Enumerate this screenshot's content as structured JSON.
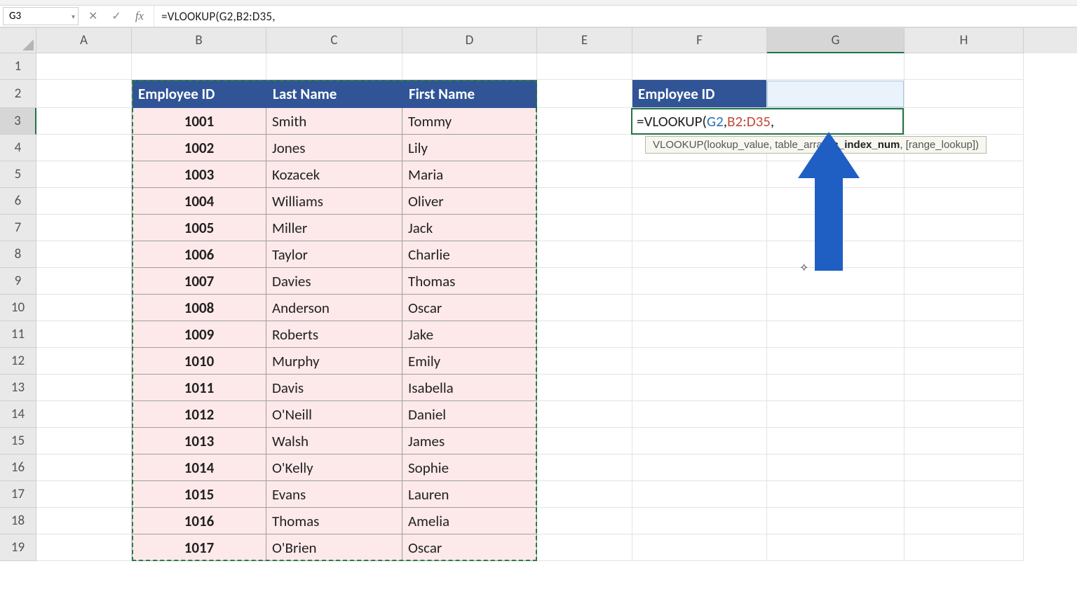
{
  "formula_bar": {
    "name_box": "G3",
    "cancel": "✕",
    "enter": "✓",
    "fx": "fx",
    "formula_text": "=VLOOKUP(G2,B2:D35,"
  },
  "columns": [
    "A",
    "B",
    "C",
    "D",
    "E",
    "F",
    "G",
    "H"
  ],
  "rows": [
    "1",
    "2",
    "3",
    "4",
    "5",
    "6",
    "7",
    "8",
    "9",
    "10",
    "11",
    "12",
    "13",
    "14",
    "15",
    "16",
    "17",
    "18",
    "19"
  ],
  "table": {
    "headers": {
      "b": "Employee ID",
      "c": "Last Name",
      "d": "First Name"
    },
    "data": [
      {
        "id": "1001",
        "last": "Smith",
        "first": "Tommy"
      },
      {
        "id": "1002",
        "last": "Jones",
        "first": "Lily"
      },
      {
        "id": "1003",
        "last": "Kozacek",
        "first": "Maria"
      },
      {
        "id": "1004",
        "last": "Williams",
        "first": "Oliver"
      },
      {
        "id": "1005",
        "last": "Miller",
        "first": "Jack"
      },
      {
        "id": "1006",
        "last": "Taylor",
        "first": "Charlie"
      },
      {
        "id": "1007",
        "last": "Davies",
        "first": "Thomas"
      },
      {
        "id": "1008",
        "last": "Anderson",
        "first": "Oscar"
      },
      {
        "id": "1009",
        "last": "Roberts",
        "first": "Jake"
      },
      {
        "id": "1010",
        "last": "Murphy",
        "first": "Emily"
      },
      {
        "id": "1011",
        "last": "Davis",
        "first": "Isabella"
      },
      {
        "id": "1012",
        "last": "O'Neill",
        "first": "Daniel"
      },
      {
        "id": "1013",
        "last": "Walsh",
        "first": "James"
      },
      {
        "id": "1014",
        "last": "O'Kelly",
        "first": "Sophie"
      },
      {
        "id": "1015",
        "last": "Evans",
        "first": "Lauren"
      },
      {
        "id": "1016",
        "last": "Thomas",
        "first": "Amelia"
      },
      {
        "id": "1017",
        "last": "O'Brien",
        "first": "Oscar"
      }
    ]
  },
  "lookup_panel": {
    "label": "Employee ID",
    "formula_prefix": "=VLOOKUP(",
    "ref1": "G2",
    "ref2": "B2:D35",
    "formula_suffix": ","
  },
  "tooltip": {
    "prefix": "VLOOKUP(lookup_value, table_array, ",
    "bold_partial_left": "c",
    "bold_partial_right": "_index_num",
    "suffix": ", [range_lookup])"
  },
  "arrow_color": "#1f5fc4"
}
